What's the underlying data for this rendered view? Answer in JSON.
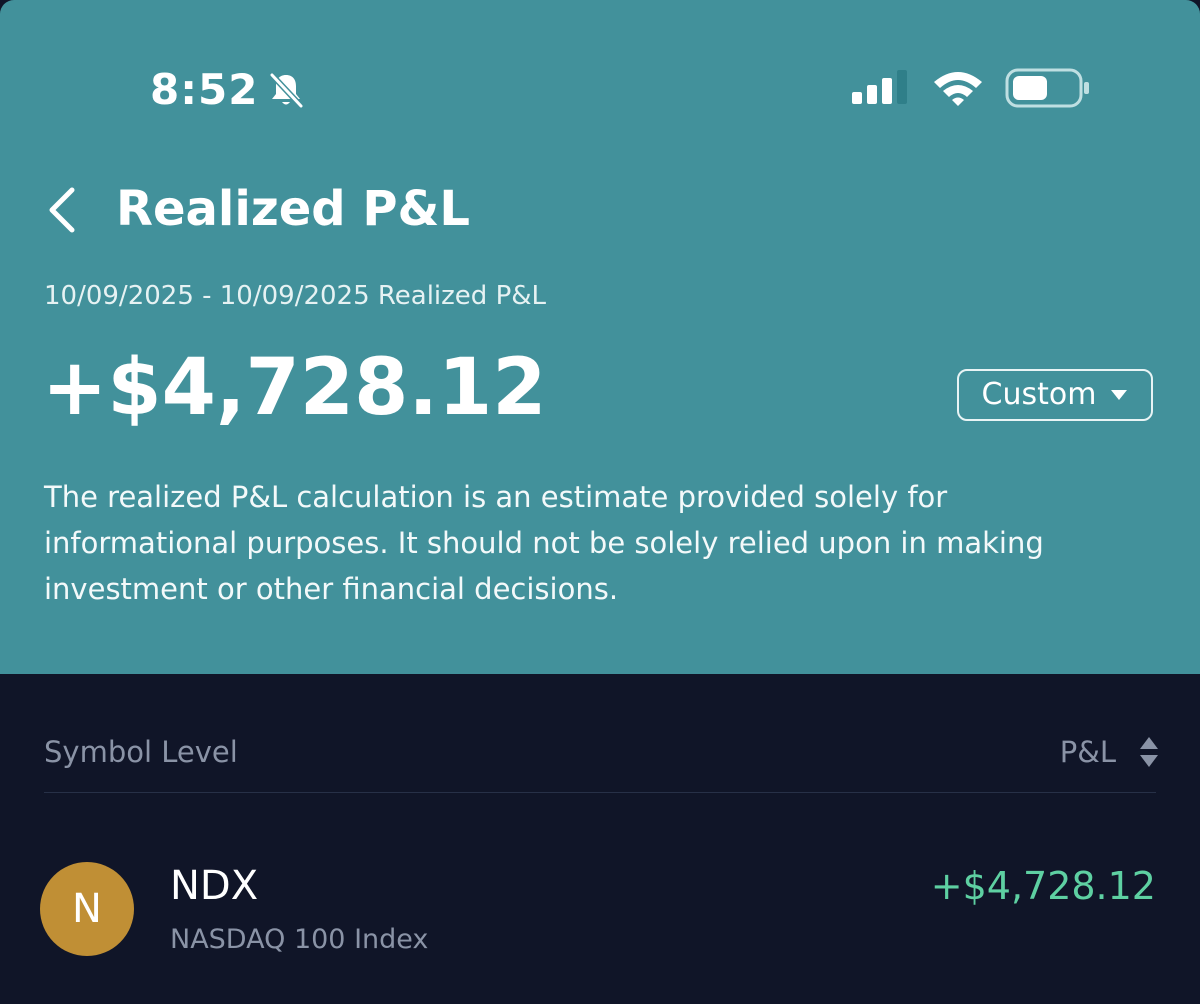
{
  "status_bar": {
    "time": "8:52"
  },
  "icons": {
    "bell": "bell-slash-icon",
    "signal": "cellular-signal-icon",
    "wifi": "wifi-icon",
    "battery": "battery-icon",
    "back": "chevron-left-icon",
    "dropdown": "caret-down-icon",
    "sort": "sort-icon"
  },
  "header": {
    "title": "Realized P&L",
    "date_range": "10/09/2025 - 10/09/2025 Realized P&L",
    "total_amount": "+$4,728.12",
    "range_selector": "Custom",
    "disclaimer": "The realized P&L calculation is an estimate provided solely for informational purposes. It should not be solely relied upon in making investment or other financial decisions."
  },
  "list": {
    "column_left": "Symbol Level",
    "column_right": "P&L",
    "rows": [
      {
        "avatar_letter": "N",
        "symbol": "NDX",
        "name": "NASDAQ 100 Index",
        "pnl": "+$4,728.12"
      }
    ]
  },
  "colors": {
    "header_bg": "#42919b",
    "body_bg": "#101528",
    "positive": "#5ed0a2",
    "avatar_bg": "#c08f35",
    "muted_text": "#8a93a6"
  }
}
